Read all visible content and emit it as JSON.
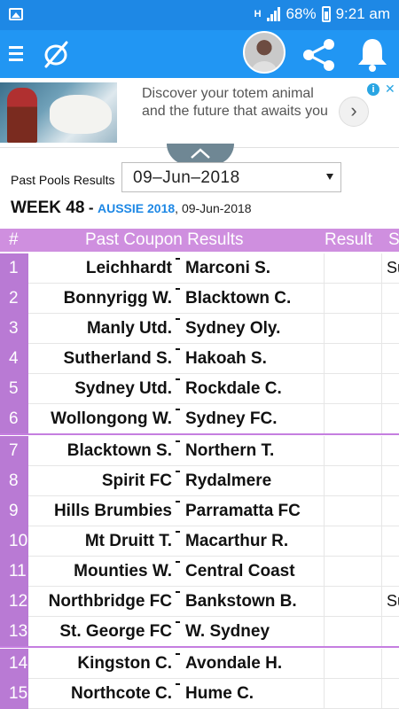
{
  "status_bar": {
    "battery": "68%",
    "time": "9:21 am",
    "network": "H"
  },
  "ad": {
    "text": "Discover your totem animal and the future that awaits you",
    "next_symbol": "›",
    "info_symbol": "i",
    "close_symbol": "✕"
  },
  "pools": {
    "label": "Past Pools Results",
    "selected_date": "09–Jun–2018"
  },
  "week": {
    "title": "WEEK 48",
    "dash": "-",
    "league": "AUSSIE 2018",
    "date": ", 09-Jun-2018"
  },
  "table": {
    "headers": {
      "num": "#",
      "coupon": "Past Coupon Results",
      "result": "Result",
      "extra": "S"
    },
    "rows": [
      {
        "num": "1",
        "home": "Leichhardt",
        "away": "Marconi S.",
        "extra": "Su"
      },
      {
        "num": "2",
        "home": "Bonnyrigg W.",
        "away": "Blacktown C.",
        "extra": ""
      },
      {
        "num": "3",
        "home": "Manly Utd.",
        "away": "Sydney Oly.",
        "extra": ""
      },
      {
        "num": "4",
        "home": "Sutherland S.",
        "away": "Hakoah S.",
        "extra": ""
      },
      {
        "num": "5",
        "home": "Sydney Utd.",
        "away": "Rockdale C.",
        "extra": ""
      },
      {
        "num": "6",
        "home": "Wollongong W.",
        "away": "Sydney FC.",
        "extra": ""
      },
      {
        "num": "7",
        "home": "Blacktown S.",
        "away": "Northern T.",
        "extra": ""
      },
      {
        "num": "8",
        "home": "Spirit FC",
        "away": "Rydalmere",
        "extra": ""
      },
      {
        "num": "9",
        "home": "Hills Brumbies",
        "away": "Parramatta FC",
        "extra": ""
      },
      {
        "num": "10",
        "home": "Mt Druitt T.",
        "away": "Macarthur R.",
        "extra": ""
      },
      {
        "num": "11",
        "home": "Mounties W.",
        "away": "Central Coast",
        "extra": ""
      },
      {
        "num": "12",
        "home": "Northbridge FC",
        "away": "Bankstown B.",
        "extra": "Su"
      },
      {
        "num": "13",
        "home": "St. George FC",
        "away": "W. Sydney",
        "extra": ""
      },
      {
        "num": "14",
        "home": "Kingston C.",
        "away": "Avondale H.",
        "extra": ""
      },
      {
        "num": "15",
        "home": "Northcote C.",
        "away": "Hume C.",
        "extra": ""
      }
    ]
  },
  "colors": {
    "status_bar": "#1e88e5",
    "app_bar": "#2196f3",
    "table_header": "#cf8fdf",
    "number_column": "#b97ad4",
    "league_text": "#1e88e5"
  }
}
